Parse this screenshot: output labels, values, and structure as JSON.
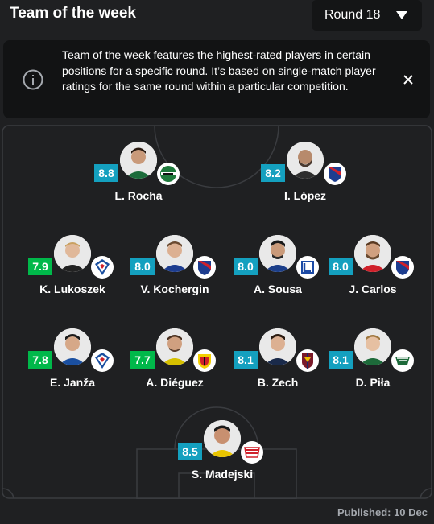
{
  "header": {
    "title": "Team of the week",
    "round_label": "Round 18"
  },
  "info": {
    "text": "Team of the week features the highest-rated players in certain positions for a specific round. It’s based on single-match player ratings for the same round within a particular competition."
  },
  "colors": {
    "rating_blue": "#14a0bf",
    "rating_green": "#00b84a",
    "background": "#1f2022"
  },
  "players": [
    {
      "name": "L. Rocha",
      "rating": "8.8",
      "rating_color": "blue",
      "team_logo": "radomiak-logo"
    },
    {
      "name": "I. López",
      "rating": "8.2",
      "rating_color": "blue",
      "team_logo": "rakow-logo"
    },
    {
      "name": "K. Lukoszek",
      "rating": "7.9",
      "rating_color": "green",
      "team_logo": "gornik-logo"
    },
    {
      "name": "V. Kochergin",
      "rating": "8.0",
      "rating_color": "blue",
      "team_logo": "rakow-logo"
    },
    {
      "name": "A. Sousa",
      "rating": "8.0",
      "rating_color": "blue",
      "team_logo": "lech-logo"
    },
    {
      "name": "J. Carlos",
      "rating": "8.0",
      "rating_color": "blue",
      "team_logo": "rakow-logo"
    },
    {
      "name": "E. Janža",
      "rating": "7.8",
      "rating_color": "green",
      "team_logo": "gornik-logo"
    },
    {
      "name": "A. Diéguez",
      "rating": "7.7",
      "rating_color": "green",
      "team_logo": "jagiellonia-logo"
    },
    {
      "name": "B. Zech",
      "rating": "8.1",
      "rating_color": "blue",
      "team_logo": "pogon-logo"
    },
    {
      "name": "D. Piła",
      "rating": "8.1",
      "rating_color": "blue",
      "team_logo": "lechia-logo"
    },
    {
      "name": "S. Madejski",
      "rating": "8.5",
      "rating_color": "blue",
      "team_logo": "cracovia-logo"
    }
  ],
  "footer": {
    "published": "Published: 10 Dec"
  }
}
